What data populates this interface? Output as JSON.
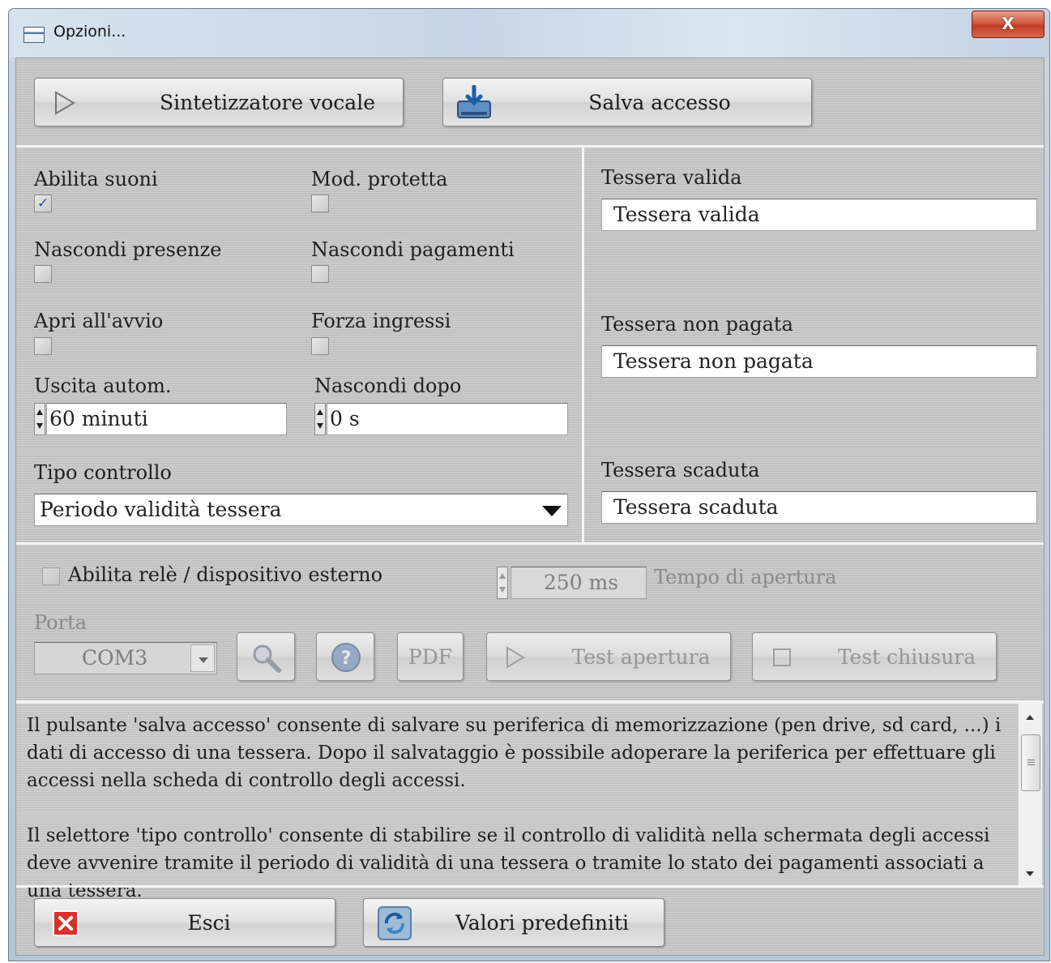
{
  "window": {
    "title": "Opzioni...",
    "close_glyph": "X"
  },
  "toolbar": {
    "speech_label": "Sintetizzatore vocale",
    "save_access_label": "Salva accesso"
  },
  "options": {
    "abilita_suoni": {
      "label": "Abilita suoni",
      "checked": true
    },
    "mod_protetta": {
      "label": "Mod. protetta",
      "checked": false
    },
    "nascondi_presenze": {
      "label": "Nascondi presenze",
      "checked": false
    },
    "nascondi_pagamenti": {
      "label": "Nascondi pagamenti",
      "checked": false
    },
    "apri_avvio": {
      "label": "Apri all'avvio",
      "checked": false
    },
    "forza_ingressi": {
      "label": "Forza ingressi",
      "checked": false
    },
    "uscita_autom": {
      "label": "Uscita autom.",
      "value": "60 minuti"
    },
    "nascondi_dopo": {
      "label": "Nascondi dopo",
      "value": "0 s"
    },
    "tipo_controllo": {
      "label": "Tipo controllo",
      "selected": "Periodo validità tessera"
    }
  },
  "messages": {
    "valida": {
      "label": "Tessera valida",
      "value": "Tessera valida"
    },
    "non_pagata": {
      "label": "Tessera non pagata",
      "value": "Tessera non pagata"
    },
    "scaduta": {
      "label": "Tessera scaduta",
      "value": "Tessera scaduta"
    }
  },
  "relay": {
    "enable_label": "Abilita relè / dispositivo esterno",
    "enabled": false,
    "opening_time_value": "250 ms",
    "opening_time_label": "Tempo di apertura",
    "port_label": "Porta",
    "port_value": "COM3",
    "pdf_label": "PDF",
    "test_open_label": "Test apertura",
    "test_close_label": "Test chiusura"
  },
  "help_text": [
    "Il pulsante 'salva accesso' consente di salvare su periferica di memorizzazione (pen drive, sd card, ...) i dati di accesso di una tessera. Dopo il salvataggio è possibile adoperare la periferica per effettuare gli accessi nella scheda di controllo degli accessi.",
    "Il selettore 'tipo controllo' consente di stabilire se il controllo di validità nella schermata degli accessi deve avvenire tramite il periodo di validità di una  tessera o tramite lo stato dei pagamenti associati a una tessera."
  ],
  "footer": {
    "exit_label": "Esci",
    "defaults_label": "Valori predefiniti"
  },
  "colors": {
    "exit_icon": "#d9302c",
    "close_button": "#c8452b",
    "check_mark": "#2d4f9c"
  }
}
